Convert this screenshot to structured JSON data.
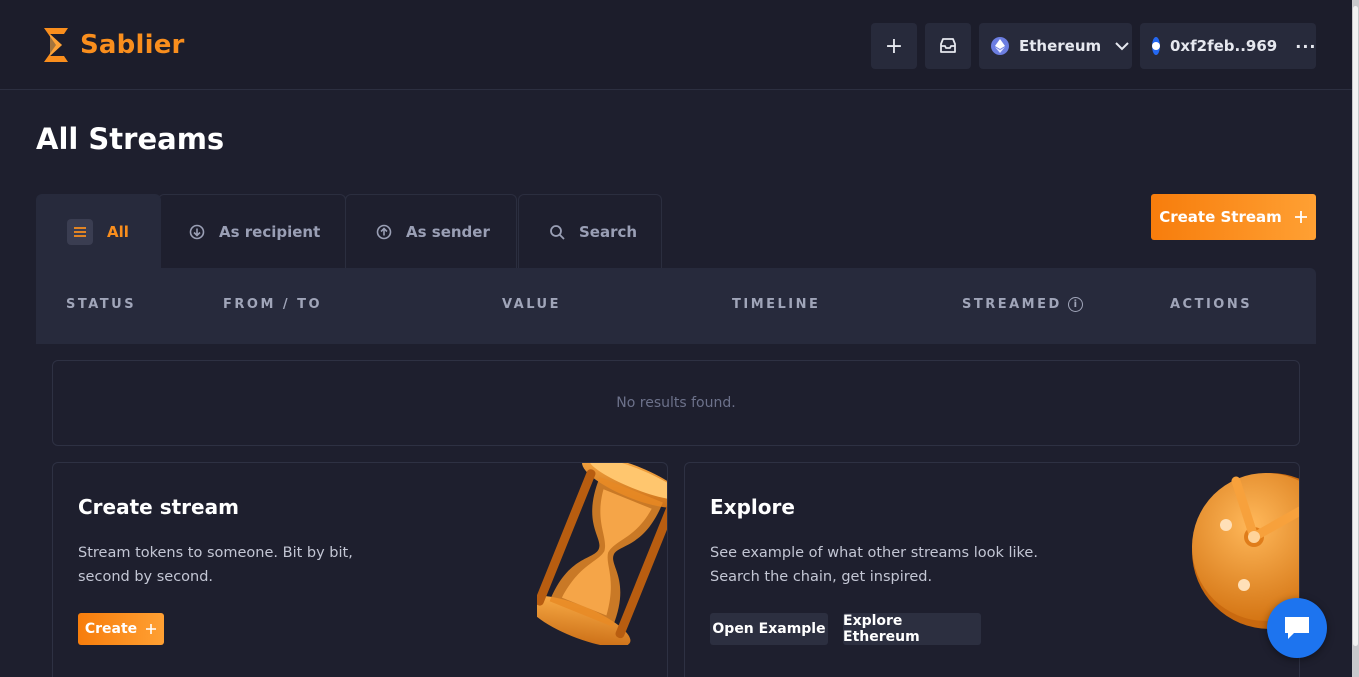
{
  "brand": {
    "name": "Sablier",
    "accent": "#f98e1d"
  },
  "header": {
    "chain_label": "Ethereum",
    "wallet_label": "0xf2feb..969",
    "more_label": "···",
    "plus_label": "+"
  },
  "page": {
    "title": "All Streams"
  },
  "tabs": [
    {
      "label": "All",
      "icon": "menu-icon",
      "active": true
    },
    {
      "label": "As recipient",
      "icon": "arrow-down-circle-icon",
      "active": false
    },
    {
      "label": "As sender",
      "icon": "arrow-up-circle-icon",
      "active": false
    },
    {
      "label": "Search",
      "icon": "search-icon",
      "active": false
    }
  ],
  "create_stream_button": {
    "label": "Create Stream"
  },
  "table": {
    "columns": [
      "STATUS",
      "FROM / TO",
      "VALUE",
      "TIMELINE",
      "STREAMED",
      "ACTIONS"
    ],
    "empty_text": "No results found."
  },
  "cards": {
    "create": {
      "title": "Create stream",
      "description": "Stream tokens to someone. Bit by bit, second by second.",
      "button_label": "Create"
    },
    "explore": {
      "title": "Explore",
      "description": "See example of what other streams look like. Search the chain, get inspired.",
      "open_example_label": "Open Example",
      "explore_chain_label": "Explore Ethereum"
    }
  },
  "chat": {
    "icon": "chat-icon"
  }
}
